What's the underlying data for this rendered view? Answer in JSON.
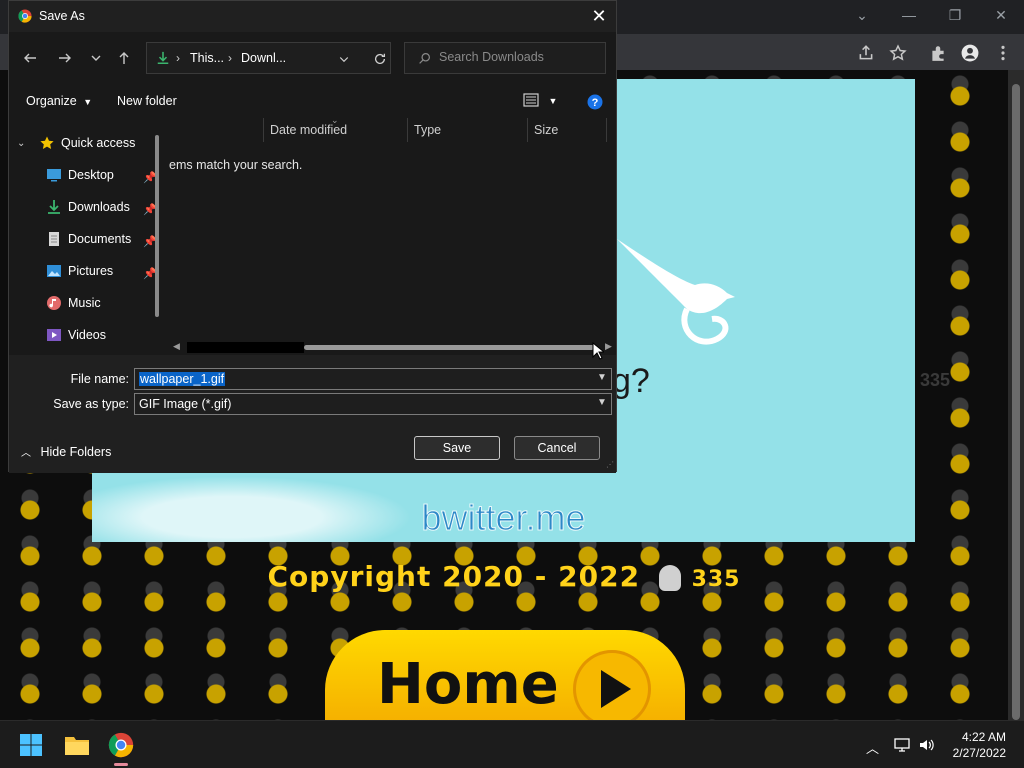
{
  "dialog": {
    "title": "Save As",
    "breadcrumb": [
      "This...",
      "Downl..."
    ],
    "search_placeholder": "Search Downloads",
    "organize_label": "Organize",
    "new_folder_label": "New folder",
    "nav": [
      {
        "label": "Quick access",
        "icon": "star-icon"
      },
      {
        "label": "Desktop",
        "icon": "desktop-icon",
        "pinned": true
      },
      {
        "label": "Downloads",
        "icon": "download-icon",
        "pinned": true
      },
      {
        "label": "Documents",
        "icon": "document-icon",
        "pinned": true
      },
      {
        "label": "Pictures",
        "icon": "pictures-icon",
        "pinned": true
      },
      {
        "label": "Music",
        "icon": "music-icon"
      },
      {
        "label": "Videos",
        "icon": "videos-icon"
      }
    ],
    "columns": [
      "Date modified",
      "Type",
      "Size"
    ],
    "empty_message": "ems match your search.",
    "file_name_label": "File name:",
    "file_name_value": "wallpaper_1.gif",
    "save_type_label": "Save as type:",
    "save_type_value": "GIF Image (*.gif)",
    "save_label": "Save",
    "cancel_label": "Cancel",
    "hide_folders_label": "Hide Folders"
  },
  "webpage": {
    "question_fragment": "g?",
    "brand": "bwitter.me",
    "copyright": "Copyright 2020 - 2022",
    "logo_text": "335",
    "home_label": "Home",
    "tile_text": "335"
  },
  "taskbar": {
    "time": "4:22 AM",
    "date": "2/27/2022"
  },
  "colors": {
    "accent": "#0a64c8",
    "wall": "#94e1e8",
    "gold": "#ffd21a"
  }
}
